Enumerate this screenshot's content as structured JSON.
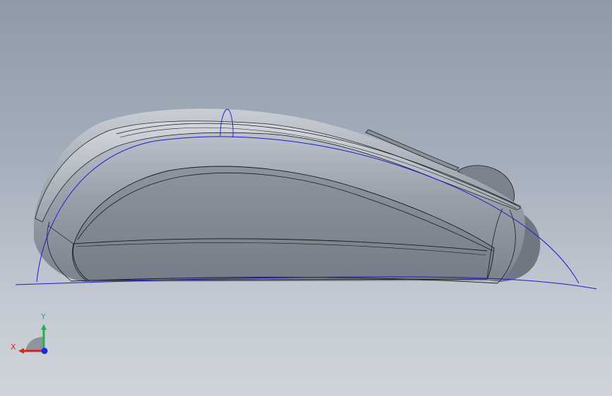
{
  "viewport": {
    "model": "computer-mouse-side-view",
    "colors": {
      "background_top": "#8f9aa8",
      "background_bottom": "#cfd4db",
      "body_fill": "#7d8591",
      "edge": "#1a1a1a",
      "sketch_curve": "#1a1ad6"
    }
  },
  "triad": {
    "x_label": "X",
    "y_label": "Y",
    "x_color": "#e0201a",
    "y_color": "#22b14c",
    "z_color": "#1a2ad6"
  }
}
